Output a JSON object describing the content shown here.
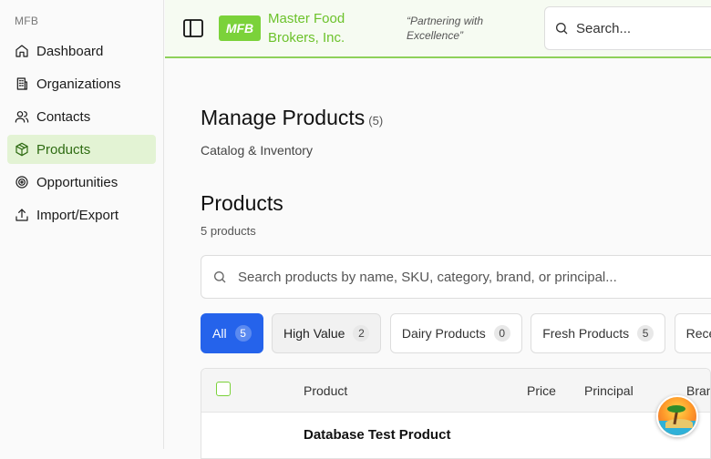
{
  "sidebar": {
    "section_label": "MFB",
    "items": [
      {
        "label": "Dashboard",
        "icon": "home-icon",
        "active": false
      },
      {
        "label": "Organizations",
        "icon": "building-icon",
        "active": false
      },
      {
        "label": "Contacts",
        "icon": "users-icon",
        "active": false
      },
      {
        "label": "Products",
        "icon": "package-icon",
        "active": true
      },
      {
        "label": "Opportunities",
        "icon": "target-icon",
        "active": false
      },
      {
        "label": "Import/Export",
        "icon": "upload-icon",
        "active": false
      }
    ]
  },
  "header": {
    "logo_text": "MFB",
    "brand_name": "Master Food Brokers, Inc.",
    "tagline": "“Partnering with Excellence”",
    "search_placeholder": "Search..."
  },
  "page": {
    "title": "Manage Products",
    "title_count": "(5)",
    "subtitle": "Catalog & Inventory",
    "section_title": "Products",
    "section_count": "5 products",
    "search_placeholder": "Search products by name, SKU, category, brand, or principal..."
  },
  "filters": [
    {
      "label": "All",
      "count": "5",
      "state": "active"
    },
    {
      "label": "High Value",
      "count": "2",
      "state": "muted"
    },
    {
      "label": "Dairy Products",
      "count": "0",
      "state": "default"
    },
    {
      "label": "Fresh Products",
      "count": "5",
      "state": "default"
    },
    {
      "label": "Rece",
      "count": "",
      "state": "default"
    }
  ],
  "table": {
    "columns": [
      "Product",
      "Price",
      "Principal",
      "Bran"
    ],
    "rows": [
      {
        "product": "Database Test Product"
      }
    ]
  },
  "colors": {
    "accent_green": "#7bd23a",
    "active_blue": "#2563eb",
    "active_nav_bg": "#e3f3d4"
  }
}
